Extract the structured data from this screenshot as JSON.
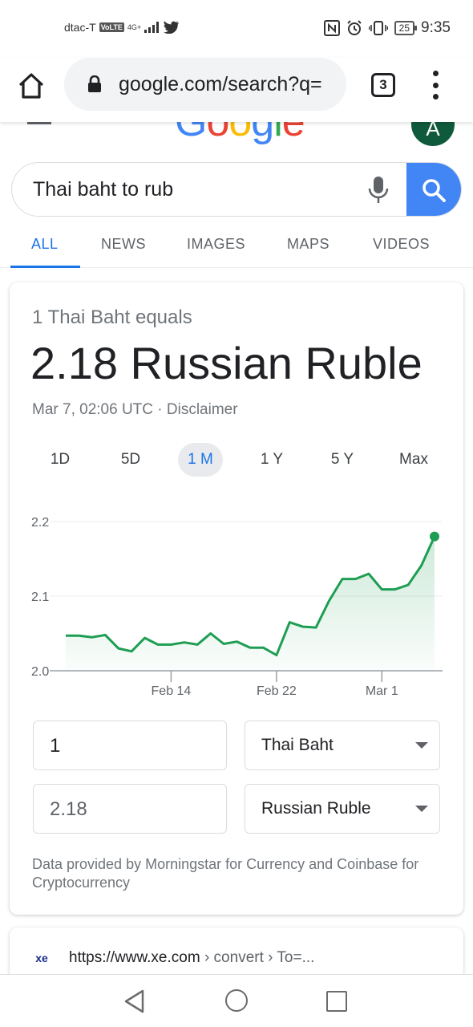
{
  "status_bar": {
    "carrier": "dtac-T",
    "volte": "VoLTE",
    "network": "4G+",
    "battery": "25",
    "time": "9:35"
  },
  "browser": {
    "url": "google.com/search?q=",
    "tab_count": "3"
  },
  "google": {
    "logo": "Google",
    "avatar_letter": "A"
  },
  "search": {
    "query": "Thai baht to rub"
  },
  "nav_tabs": [
    "ALL",
    "NEWS",
    "IMAGES",
    "MAPS",
    "VIDEOS"
  ],
  "converter": {
    "equals_label": "1 Thai Baht equals",
    "result": "2.18 Russian Ruble",
    "timestamp": "Mar 7, 02:06 UTC · Disclaimer",
    "ranges": [
      "1D",
      "5D",
      "1 M",
      "1 Y",
      "5 Y",
      "Max"
    ],
    "active_range": "1 M",
    "from_amount": "1",
    "from_currency": "Thai Baht",
    "to_amount": "2.18",
    "to_currency": "Russian Ruble",
    "provider_note": "Data provided by Morningstar for Currency and Coinbase for Cryptocurrency"
  },
  "chart_data": {
    "type": "area",
    "y_ticks": [
      "2.2",
      "2.1",
      "2.0"
    ],
    "x_ticks": [
      "Feb 14",
      "Feb 22",
      "Mar 1"
    ],
    "ylim": [
      2.0,
      2.2
    ],
    "grid": true,
    "color": "#1e9e52",
    "values": [
      2.047,
      2.047,
      2.045,
      2.048,
      2.03,
      2.026,
      2.044,
      2.035,
      2.035,
      2.038,
      2.035,
      2.05,
      2.036,
      2.039,
      2.031,
      2.031,
      2.021,
      2.065,
      2.059,
      2.058,
      2.094,
      2.123,
      2.123,
      2.13,
      2.109,
      2.109,
      2.115,
      2.141,
      2.18
    ],
    "x_tick_index": [
      8,
      16,
      24
    ]
  },
  "next_result": {
    "url": "https://www.xe.com",
    "crumb": " › convert › To=...",
    "logo": "xe"
  },
  "colors": {
    "accent": "#1a73e8",
    "search_button": "#4285f4",
    "chart_line": "#1e9e52",
    "avatar_bg": "#0f5a3c"
  }
}
